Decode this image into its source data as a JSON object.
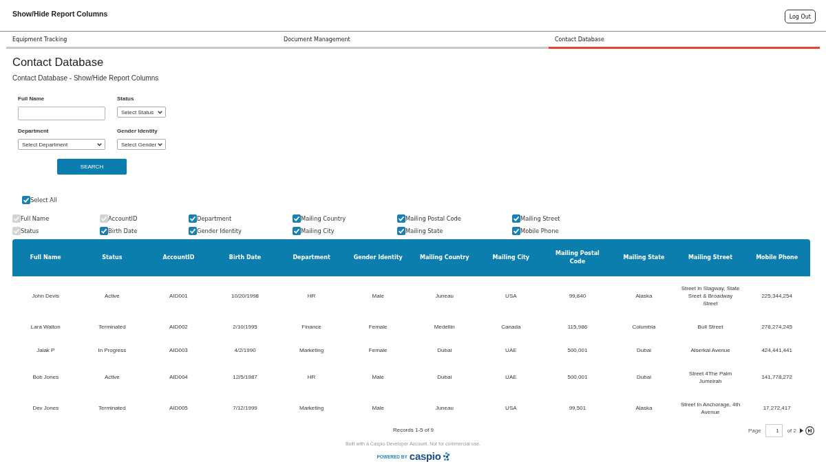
{
  "header": {
    "title": "Show/Hide Report Columns",
    "logout": "Log Out"
  },
  "tabs": [
    {
      "label": "Equipment Tracking",
      "selected": false
    },
    {
      "label": "Document Management",
      "selected": false
    },
    {
      "label": "Contact Database",
      "selected": true
    }
  ],
  "page": {
    "title": "Contact Database",
    "subtitle": "Contact Database - Show/Hide Report Columns"
  },
  "search_form": {
    "fields": [
      {
        "label": "Full Name",
        "kind": "text"
      },
      {
        "label": "Status",
        "kind": "select",
        "value": "Select Status"
      },
      {
        "label": "Department",
        "kind": "select",
        "value": "Select Department"
      },
      {
        "label": "Gender Identity",
        "kind": "select",
        "value": "Select Gender"
      }
    ],
    "button": "SEARCH"
  },
  "column_toggles": {
    "select_all": {
      "label": "Select All",
      "checked": true
    },
    "items": [
      {
        "label": "Full Name",
        "checked": true,
        "disabled": true
      },
      {
        "label": "AccountID",
        "checked": true,
        "disabled": true
      },
      {
        "label": "Department",
        "checked": true,
        "disabled": false
      },
      {
        "label": "Mailing Country",
        "checked": true,
        "disabled": false
      },
      {
        "label": "Mailing Postal Code",
        "checked": true,
        "disabled": false
      },
      {
        "label": "Mailing Street",
        "checked": true,
        "disabled": false
      },
      {
        "label": "Status",
        "checked": true,
        "disabled": true
      },
      {
        "label": "Birth Date",
        "checked": true,
        "disabled": false
      },
      {
        "label": "Gender Identity",
        "checked": true,
        "disabled": false
      },
      {
        "label": "Mailing City",
        "checked": true,
        "disabled": false
      },
      {
        "label": "Mailing State",
        "checked": true,
        "disabled": false
      },
      {
        "label": "Mobile Phone",
        "checked": true,
        "disabled": false
      }
    ]
  },
  "table": {
    "columns": [
      "Full Name",
      "Status",
      "AccountID",
      "Birth Date",
      "Department",
      "Gender Identity",
      "Mailing Country",
      "Mailing City",
      "Mailing Postal Code",
      "Mailing State",
      "Mailing Street",
      "Mobile Phone"
    ],
    "rows": [
      [
        "John Devis",
        "Active",
        "AID001",
        "10/20/1998",
        "HR",
        "Male",
        "Juneau",
        "USA",
        "99,840",
        "Alaska",
        "Street in Slagway, State Sreet & Broadway Street",
        "225,344,254"
      ],
      [
        "Lara Walton",
        "Terminated",
        "AID002",
        "2/10/1995",
        "Finance",
        "Female",
        "Medellin",
        "Canada",
        "115,986",
        "Columbia",
        "Bull Street",
        "278,274,245"
      ],
      [
        "Jalak P",
        "In Progress",
        "AID003",
        "4/2/1990",
        "Marketing",
        "Female",
        "Dubai",
        "UAE",
        "500,001",
        "Dubai",
        "Alserkal Avenue",
        "424,441,441"
      ],
      [
        "Bob Jones",
        "Active",
        "AID004",
        "12/5/1987",
        "HR",
        "Male",
        "Dubai",
        "UAE",
        "500,001",
        "Dubai",
        "Street 4The Palm Jumeirah",
        "141,778,272"
      ],
      [
        "Dev Jones",
        "Terminated",
        "AID005",
        "7/12/1999",
        "Marketing",
        "Male",
        "Juneau",
        "USA",
        "99,501",
        "Alaska",
        "Street In Anchorage, 4th Avenue",
        "17,272,417"
      ]
    ]
  },
  "footer": {
    "records": "Records 1-5 of 9",
    "pager": {
      "label": "Page",
      "value": "1",
      "total": "of 2"
    },
    "notice": "Built with a Caspio Developer Account. Not for commercial use.",
    "powered_by": "POWERED BY",
    "brand": "caspio"
  }
}
